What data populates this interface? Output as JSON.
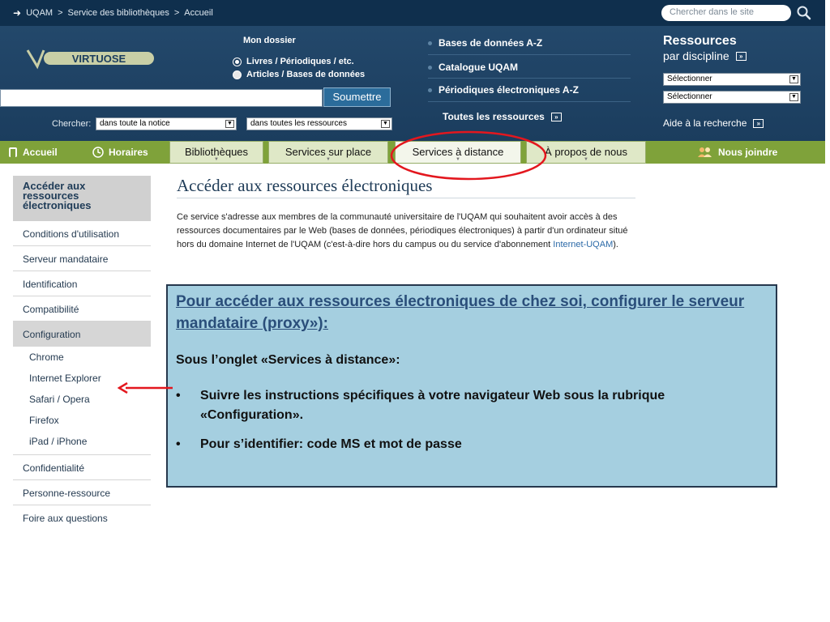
{
  "topbar": {
    "crumbs": [
      "UQAM",
      ">",
      "Service des bibliothèques",
      ">",
      "Accueil"
    ],
    "search_placeholder": "Chercher dans le site"
  },
  "header": {
    "logo_text": "VIRTUOSE",
    "mon_dossier": "Mon dossier",
    "radio1": "Livres / Périodiques / etc.",
    "radio2": "Articles / Bases de données",
    "submit": "Soumettre",
    "chercher_label": "Chercher:",
    "select1": "dans toute la notice",
    "select2": "dans toutes les ressources",
    "links": [
      "Bases de données A-Z",
      "Catalogue UQAM",
      "Périodiques électroniques A-Z"
    ],
    "all_resources": "Toutes les ressources",
    "res_title": "Ressources",
    "res_sub": "par discipline",
    "res_select1": "Sélectionner",
    "res_select2": "Sélectionner",
    "aide": "Aide à la recherche"
  },
  "nav": {
    "accueil": "Accueil",
    "horaires": "Horaires",
    "tabs": [
      "Bibliothèques",
      "Services sur place",
      "Services à distance",
      "À propos de nous"
    ],
    "nous_joindre": "Nous joindre"
  },
  "sidebar": {
    "header": "Accéder aux ressources électroniques",
    "items": [
      "Conditions d'utilisation",
      "Serveur mandataire",
      "Identification",
      "Compatibilité",
      "Configuration"
    ],
    "sub_items": [
      "Chrome",
      "Internet Explorer",
      "Safari / Opera",
      "Firefox",
      "iPad / iPhone"
    ],
    "items_after": [
      "Confidentialité",
      "Personne-ressource",
      "Foire aux questions"
    ]
  },
  "main": {
    "title": "Accéder aux ressources électroniques",
    "intro_1": "Ce service s'adresse aux membres de la communauté universitaire de l'UQAM qui souhaitent avoir accès à des ressources documentaires par le Web (bases de données, périodiques électroniques) à partir d'un ordinateur situé hors du domaine Internet de l'UQAM (c'est-à-dire hors du campus ou du service d'abonnement ",
    "intro_link": "Internet-UQAM",
    "intro_2": ")."
  },
  "callout": {
    "title": "Pour accéder aux ressources électroniques de chez soi,  configurer le serveur mandataire (proxy»):",
    "subtitle": "Sous l’onglet «Services à distance»:",
    "bullets": [
      "Suivre les instructions  spécifiques à votre navigateur  Web sous la rubrique «Configuration».",
      "Pour s’identifier: code MS et mot de passe"
    ]
  },
  "colors": {
    "topbar": "#0f2f4d",
    "header": "#1b3d5e",
    "nav": "#7fa23a",
    "callout_bg": "#a5cfe0",
    "annotation": "#e3171e"
  }
}
